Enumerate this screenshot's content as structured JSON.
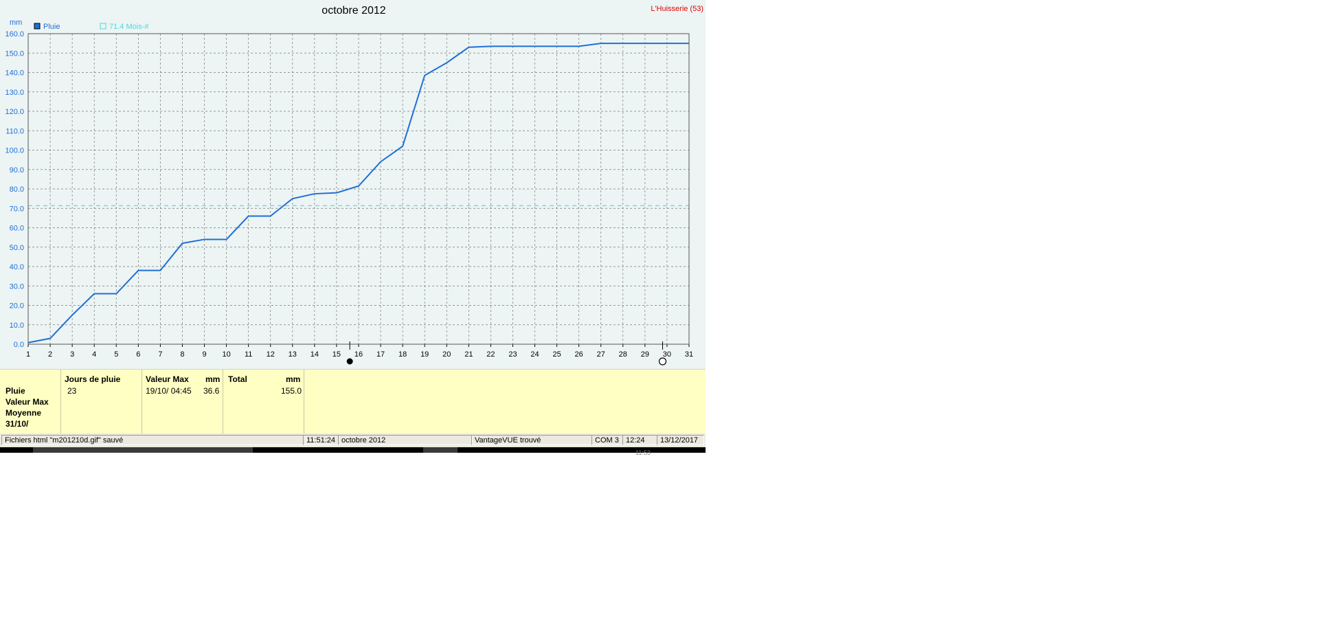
{
  "chart_data": {
    "type": "line",
    "title": "octobre 2012",
    "station": "L'Huisserie (53)",
    "ylabel": "mm",
    "ylim": [
      0,
      160
    ],
    "xlim": [
      1,
      31
    ],
    "grid": true,
    "x": [
      1,
      2,
      3,
      4,
      5,
      6,
      7,
      8,
      9,
      10,
      11,
      12,
      13,
      14,
      15,
      16,
      17,
      18,
      19,
      20,
      21,
      22,
      23,
      24,
      25,
      26,
      27,
      28,
      29,
      30,
      31
    ],
    "series": [
      {
        "name": "Pluie",
        "color": "#1f6fd6",
        "values": [
          0.8,
          3.0,
          15.0,
          26.0,
          26.0,
          38.0,
          38.0,
          52.0,
          54.0,
          54.0,
          66.0,
          66.0,
          75.0,
          77.5,
          78.0,
          81.5,
          94.0,
          102.0,
          138.5,
          145.0,
          153.0,
          153.5,
          153.5,
          153.5,
          153.5,
          153.5,
          155.0,
          155.0,
          155.0,
          155.0,
          155.0
        ]
      },
      {
        "name": "71.4 Mois-#",
        "color": "#4ad8e0",
        "style": "dashed",
        "values": [
          71.4,
          71.4,
          71.4,
          71.4,
          71.4,
          71.4,
          71.4,
          71.4,
          71.4,
          71.4,
          71.4,
          71.4,
          71.4,
          71.4,
          71.4,
          71.4,
          71.4,
          71.4,
          71.4,
          71.4,
          71.4,
          71.4,
          71.4,
          71.4,
          71.4,
          71.4,
          71.4,
          71.4,
          71.4,
          71.4,
          71.4
        ]
      }
    ],
    "yticks": [
      "0.0",
      "10.0",
      "20.0",
      "30.0",
      "40.0",
      "50.0",
      "60.0",
      "70.0",
      "80.0",
      "90.0",
      "100.0",
      "110.0",
      "120.0",
      "130.0",
      "140.0",
      "150.0",
      "160.0"
    ],
    "xticks": [
      "1",
      "2",
      "3",
      "4",
      "5",
      "6",
      "7",
      "8",
      "9",
      "10",
      "11",
      "12",
      "13",
      "14",
      "15",
      "16",
      "17",
      "18",
      "19",
      "20",
      "21",
      "22",
      "23",
      "24",
      "25",
      "26",
      "27",
      "28",
      "29",
      "30",
      "31"
    ],
    "moon_phases": [
      {
        "day": 15.6,
        "phase": "new-moon"
      },
      {
        "day": 29.8,
        "phase": "full-moon"
      }
    ]
  },
  "stats": {
    "row_labels": [
      "Pluie",
      "Valeur Max",
      "Moyenne",
      "31/10/"
    ],
    "jours": {
      "header": "Jours de pluie",
      "value": "23"
    },
    "valmax": {
      "header": "Valeur Max",
      "unit": "mm",
      "date": "19/10/  04:45",
      "value": "36.6"
    },
    "total": {
      "header": "Total",
      "unit": "mm",
      "value": "155.0"
    }
  },
  "statusbar": {
    "message": "Fichiers html  \"m201210d.gif\"  sauvé",
    "time": "11:51:24",
    "period": "octobre 2012",
    "device": "VantageVUE trouvé",
    "port": "COM 3",
    "clock": "12:24",
    "date": "13/12/2017"
  },
  "taskbar": {
    "clock": "11:53"
  }
}
